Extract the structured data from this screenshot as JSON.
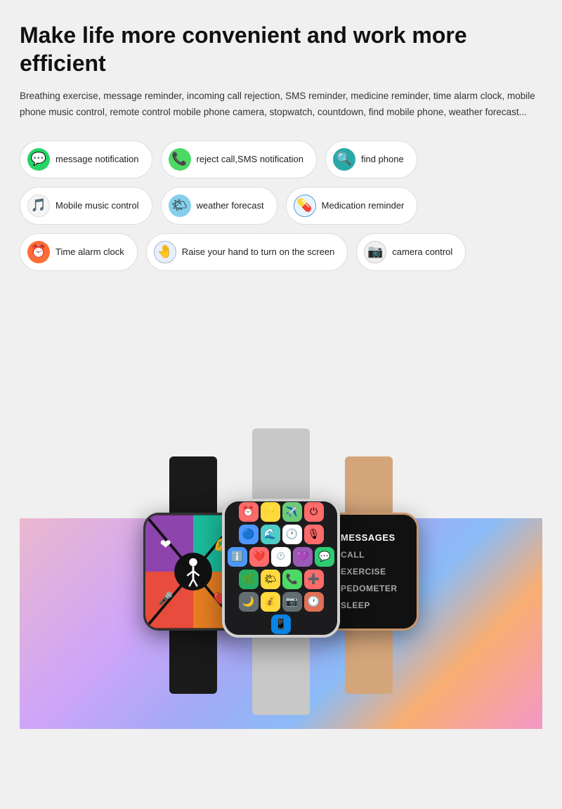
{
  "header": {
    "title": "Make life more convenient and work more efficient",
    "description": "Breathing exercise, message reminder, incoming call rejection, SMS reminder, medicine reminder, time alarm clock, mobile phone music control, remote control mobile phone camera, stopwatch, countdown, find mobile phone, weather forecast..."
  },
  "features": {
    "rows": [
      [
        {
          "id": "message-notification",
          "label": "message notification",
          "icon": "💬",
          "icon_style": "green"
        },
        {
          "id": "reject-call",
          "label": "reject call,SMS notification",
          "icon": "📞",
          "icon_style": "green2"
        },
        {
          "id": "find-phone",
          "label": "find phone",
          "icon": "🔍",
          "icon_style": "teal"
        }
      ],
      [
        {
          "id": "mobile-music",
          "label": "Mobile music control",
          "icon": "🎵",
          "icon_style": "music"
        },
        {
          "id": "weather-forecast",
          "label": "weather forecast",
          "icon": "🌤",
          "icon_style": "weather"
        },
        {
          "id": "medication-reminder",
          "label": "Medication reminder",
          "icon": "💊",
          "icon_style": "med"
        }
      ],
      [
        {
          "id": "time-alarm",
          "label": "Time alarm clock",
          "icon": "⏰",
          "icon_style": "alarm"
        },
        {
          "id": "raise-hand",
          "label": "Raise your hand to turn on the screen",
          "icon": "🤚",
          "icon_style": "hand"
        },
        {
          "id": "camera-control",
          "label": "camera control",
          "icon": "📷",
          "icon_style": "camera"
        }
      ]
    ]
  },
  "watches": {
    "left": {
      "band_color": "#1a1a1a",
      "case_color": "#222",
      "screen": "colorful-quadrant"
    },
    "center": {
      "band_color": "#c8c8c8",
      "case_color": "#d0d0d0",
      "screen": "app-grid"
    },
    "right": {
      "band_color": "#d4a57a",
      "case_color": "#c8956a",
      "screen": "menu-list",
      "menu_items": [
        "MESSAGES",
        "CALL",
        "EXERCISE",
        "PEDOMETER",
        "SLEEP"
      ]
    }
  }
}
